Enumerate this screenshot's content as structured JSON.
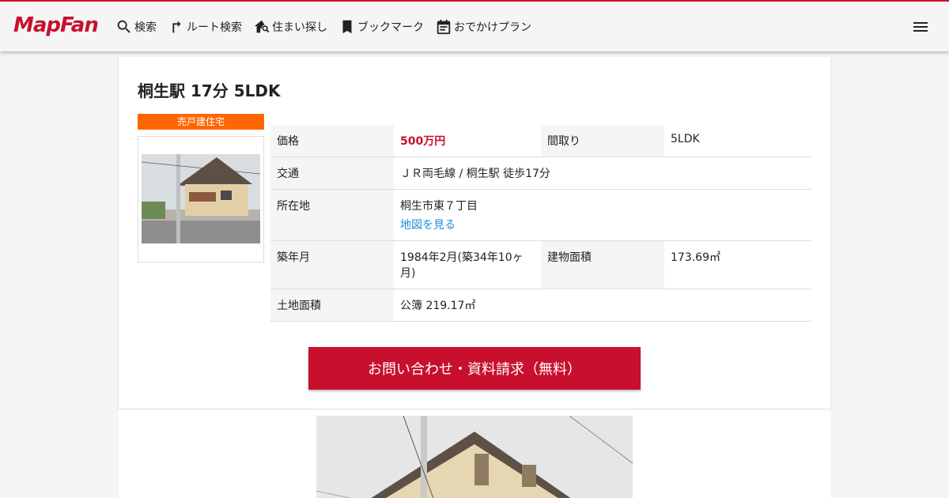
{
  "app": {
    "logo_text": "MapFan"
  },
  "nav": {
    "items": [
      {
        "label": "検索",
        "icon": "search-icon"
      },
      {
        "label": "ルート検索",
        "icon": "route-icon"
      },
      {
        "label": "住まい探し",
        "icon": "house-search-icon"
      },
      {
        "label": "ブックマーク",
        "icon": "bookmark-icon"
      },
      {
        "label": "おでかけプラン",
        "icon": "event-note-icon"
      }
    ],
    "menu_icon": "hamburger-menu-icon"
  },
  "listing": {
    "title": "桐生駅 17分 5LDK",
    "badge": "売戸建住宅",
    "rows": {
      "price_label": "価格",
      "price_value": "500万円",
      "layout_label": "間取り",
      "layout_value": "5LDK",
      "transit_label": "交通",
      "transit_value": "ＪＲ両毛線 / 桐生駅 徒歩17分",
      "address_label": "所在地",
      "address_value": "桐生市東７丁目",
      "map_link": "地図を見る",
      "built_label": "築年月",
      "built_value": "1984年2月(築34年10ヶ月)",
      "floor_label": "建物面積",
      "floor_value": "173.69㎡",
      "land_label": "土地面積",
      "land_value": "公簿 219.17㎡"
    },
    "cta_label": "お問い合わせ・資料請求（無料）"
  },
  "colors": {
    "brand": "#c8102e",
    "badge": "#ff6600",
    "link": "#1a8fd8"
  }
}
